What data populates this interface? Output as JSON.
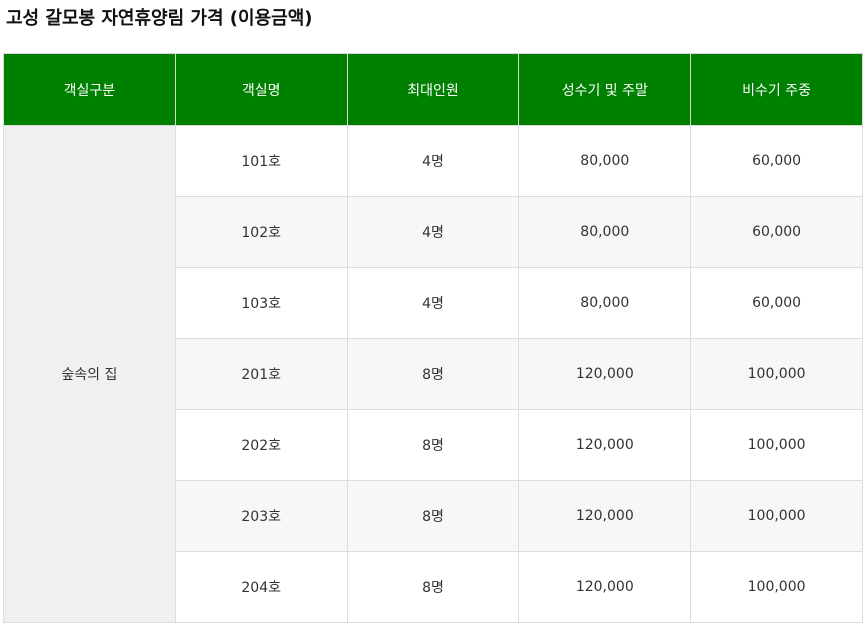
{
  "page": {
    "title": "고성 갈모봉 자연휴양림 가격 (이용금액)"
  },
  "table": {
    "headers": [
      "객실구분",
      "객실명",
      "최대인원",
      "성수기 및 주말",
      "비수기 주중"
    ],
    "group_label": "숲속의 집",
    "rows": [
      {
        "room": "101호",
        "capacity": "4명",
        "peak": "80,000",
        "offpeak": "60,000"
      },
      {
        "room": "102호",
        "capacity": "4명",
        "peak": "80,000",
        "offpeak": "60,000"
      },
      {
        "room": "103호",
        "capacity": "4명",
        "peak": "80,000",
        "offpeak": "60,000"
      },
      {
        "room": "201호",
        "capacity": "8명",
        "peak": "120,000",
        "offpeak": "100,000"
      },
      {
        "room": "202호",
        "capacity": "8명",
        "peak": "120,000",
        "offpeak": "100,000"
      },
      {
        "room": "203호",
        "capacity": "8명",
        "peak": "120,000",
        "offpeak": "100,000"
      },
      {
        "room": "204호",
        "capacity": "8명",
        "peak": "120,000",
        "offpeak": "100,000"
      }
    ]
  },
  "colors": {
    "header_bg": "#008000",
    "group_bg": "#f0f0f0",
    "alt_row_bg": "#f7f7f7"
  }
}
